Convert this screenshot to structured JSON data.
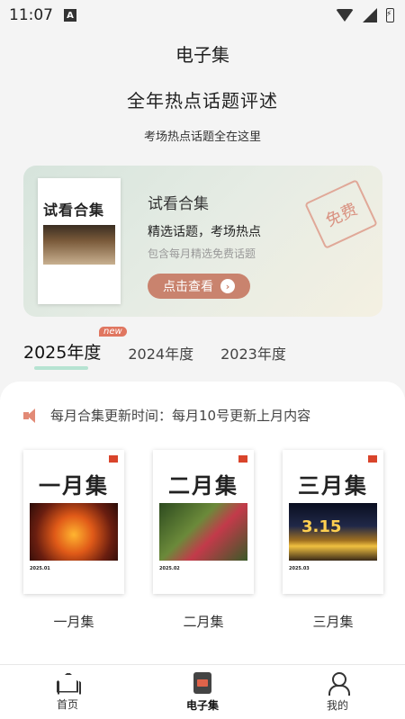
{
  "status": {
    "time": "11:07"
  },
  "titlebar": {
    "title": "电子集"
  },
  "hero": {
    "title": "全年热点话题评述",
    "subtitle": "考场热点话题全在这里"
  },
  "promo": {
    "cover_title": "试看合集",
    "title": "试看合集",
    "line1": "精选话题，考场热点",
    "line2": "包含每月精选免费话题",
    "button": "点击查看",
    "stamp": "免费"
  },
  "years": [
    {
      "label": "2025年度",
      "active": true,
      "badge": "new"
    },
    {
      "label": "2024年度"
    },
    {
      "label": "2023年度"
    }
  ],
  "notice": {
    "text": "每月合集更新时间：每月10号更新上月内容"
  },
  "books": [
    {
      "cover_title": "一月集",
      "date": "2025.01",
      "label": "一月集"
    },
    {
      "cover_title": "二月集",
      "date": "2025.02",
      "label": "二月集"
    },
    {
      "cover_title": "三月集",
      "date": "2025.03",
      "label": "三月集",
      "pic_text": "3.15"
    }
  ],
  "nav": [
    {
      "label": "首页",
      "icon": "home-icon"
    },
    {
      "label": "电子集",
      "icon": "ebook-icon",
      "active": true
    },
    {
      "label": "我的",
      "icon": "user-icon"
    }
  ]
}
